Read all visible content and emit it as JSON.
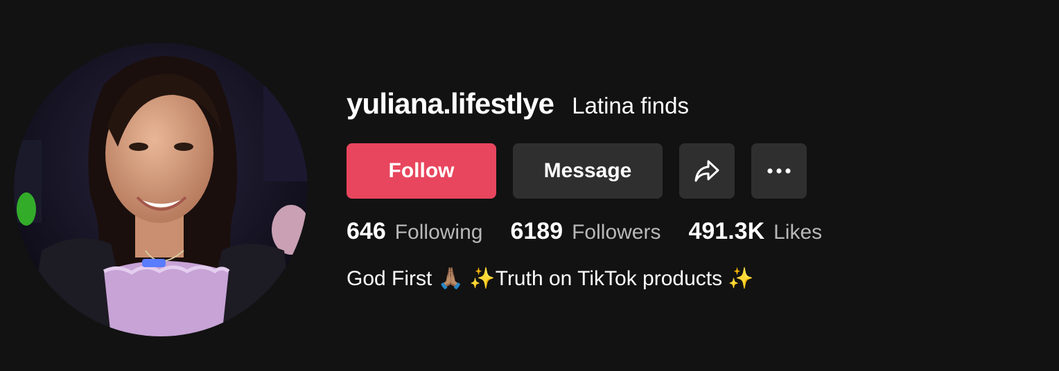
{
  "profile": {
    "username": "yuliana.lifestlye",
    "nickname": "Latina finds",
    "avatar_icon": "profile-photo"
  },
  "actions": {
    "follow_label": "Follow",
    "message_label": "Message",
    "share_icon": "share-arrow-icon",
    "more_icon": "more-dots-icon",
    "follow_color": "#e8465e",
    "secondary_color": "#2f2f2f"
  },
  "stats": {
    "following": {
      "count": "646",
      "label": "Following"
    },
    "followers": {
      "count": "6189",
      "label": "Followers"
    },
    "likes": {
      "count": "491.3K",
      "label": "Likes"
    }
  },
  "bio": "God First 🙏🏽 ✨Truth on TikTok products ✨",
  "colors": {
    "background": "#121212",
    "stat_label": "#b8b8b8"
  }
}
